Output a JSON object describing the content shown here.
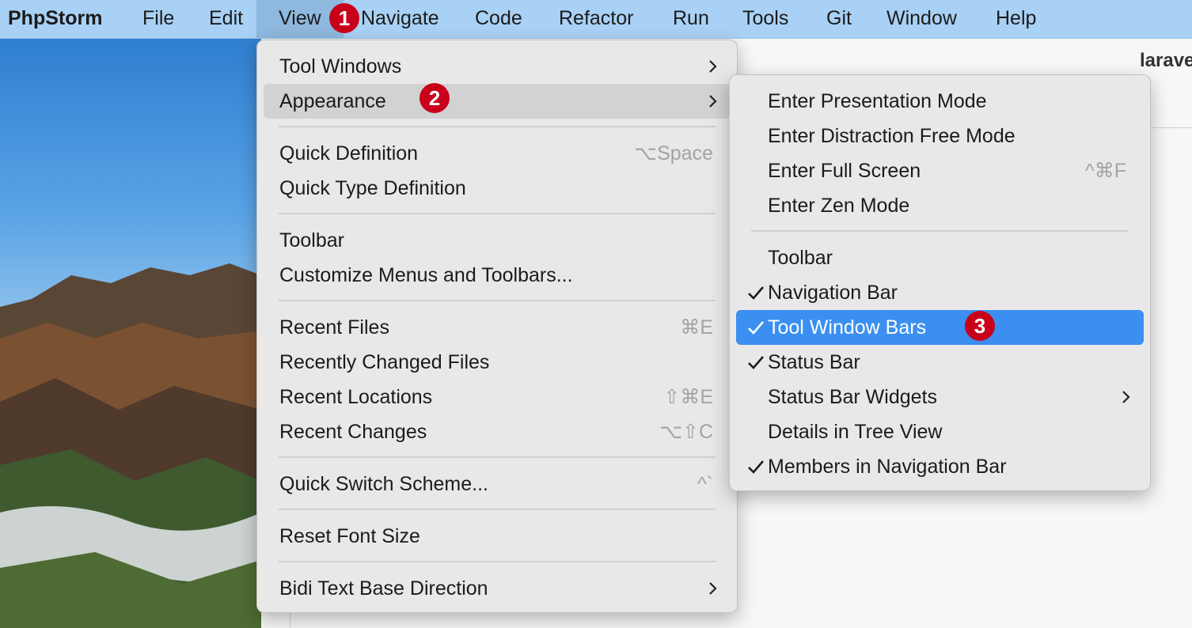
{
  "menubar": {
    "app_name": "PhpStorm",
    "items": [
      "File",
      "Edit",
      "View",
      "Navigate",
      "Code",
      "Refactor",
      "Run",
      "Tools",
      "Git",
      "Window",
      "Help"
    ],
    "active_item": "View"
  },
  "window_title": "larave",
  "view_menu": {
    "items": [
      {
        "label": "Tool Windows",
        "submenu": true
      },
      {
        "label": "Appearance",
        "submenu": true,
        "highlighted": true
      },
      {
        "label": "Quick Definition",
        "shortcut": "⌥Space"
      },
      {
        "label": "Quick Type Definition"
      },
      {
        "label": "Toolbar"
      },
      {
        "label": "Customize Menus and Toolbars..."
      },
      {
        "label": "Recent Files",
        "shortcut": "⌘E"
      },
      {
        "label": "Recently Changed Files"
      },
      {
        "label": "Recent Locations",
        "shortcut": "⇧⌘E"
      },
      {
        "label": "Recent Changes",
        "shortcut": "⌥⇧C"
      },
      {
        "label": "Quick Switch Scheme...",
        "shortcut": "^`"
      },
      {
        "label": "Reset Font Size"
      },
      {
        "label": "Bidi Text Base Direction",
        "submenu": true
      }
    ]
  },
  "appearance_menu": {
    "items": [
      {
        "label": "Enter Presentation Mode"
      },
      {
        "label": "Enter Distraction Free Mode"
      },
      {
        "label": "Enter Full Screen",
        "shortcut": "^⌘F"
      },
      {
        "label": "Enter Zen Mode"
      },
      {
        "label": "Toolbar",
        "checked": false
      },
      {
        "label": "Navigation Bar",
        "checked": true
      },
      {
        "label": "Tool Window Bars",
        "checked": true,
        "selected": true
      },
      {
        "label": "Status Bar",
        "checked": true
      },
      {
        "label": "Status Bar Widgets",
        "submenu": true
      },
      {
        "label": "Details in Tree View"
      },
      {
        "label": "Members in Navigation Bar",
        "checked": true
      }
    ]
  },
  "badges": [
    "1",
    "2",
    "3"
  ],
  "colors": {
    "menubar_bg": "#a9d1f5",
    "selection_blue": "#3b8ff0",
    "badge_red": "#c8001a"
  }
}
